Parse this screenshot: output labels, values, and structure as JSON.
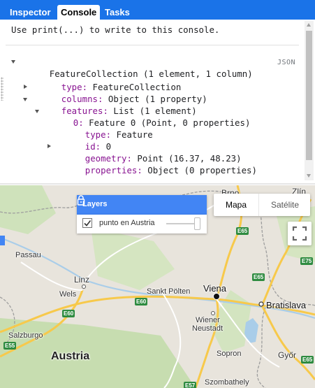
{
  "tabs": [
    {
      "label": "Inspector"
    },
    {
      "label": "Console"
    },
    {
      "label": "Tasks"
    }
  ],
  "console": {
    "hint": "Use print(...) to write to this console.",
    "json_label": "JSON",
    "tree": {
      "root": "FeatureCollection (1 element, 1 column)",
      "type_key": "type:",
      "type_val": "FeatureCollection",
      "columns_key": "columns:",
      "columns_val": "Object (1 property)",
      "features_key": "features:",
      "features_val": "List (1 element)",
      "item_key": "0:",
      "item_val": "Feature 0 (Point, 0 properties)",
      "ftype_key": "type:",
      "ftype_val": "Feature",
      "id_key": "id:",
      "id_val": "0",
      "geometry_key": "geometry:",
      "geometry_val": "Point (16.37, 48.23)",
      "properties_key": "properties:",
      "properties_val": "Object (0 properties)"
    }
  },
  "map": {
    "layers": {
      "title": "Layers",
      "layer_name": "punto en Austria",
      "layer_checked": true
    },
    "map_type": {
      "map_label": "Mapa",
      "satellite_label": "Satélite"
    },
    "places": {
      "brno": "Brno",
      "zlin": "Zlín",
      "passau": "Passau",
      "linz": "Linz",
      "wels": "Wels",
      "sankt_polten": "Sankt Pölten",
      "viena": "Viena",
      "bratislava": "Bratislava",
      "wiener_neustadt_1": "Wiener",
      "wiener_neustadt_2": "Neustadt",
      "salzburgo": "Salzburgo",
      "austria": "Austria",
      "sopron": "Sopron",
      "gyor": "Győr",
      "szombathely": "Szombathely"
    },
    "shields": {
      "e65_a": "E65",
      "e65_b": "E65",
      "e65_c": "E65",
      "e75": "E75",
      "e60_a": "E60",
      "e60_b": "E60",
      "e55": "E55",
      "e57": "E57"
    },
    "colors": {
      "land": "#e8e4dc",
      "green": "#c9dfb3",
      "water": "#a9cde9",
      "highway": "#f7c94b",
      "road": "#ffffff",
      "border": "#9e9e9e",
      "accent": "#4285f4"
    }
  }
}
